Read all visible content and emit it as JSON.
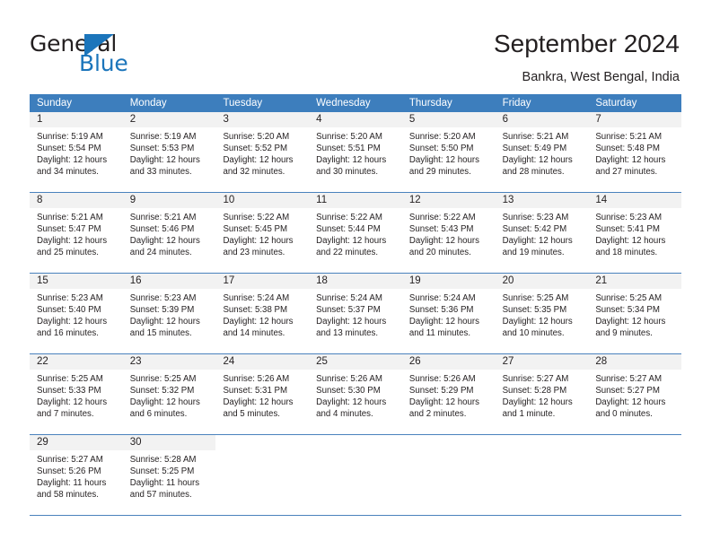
{
  "brand": {
    "name_part1": "General",
    "name_part2": "Blue"
  },
  "header": {
    "title": "September 2024",
    "subtitle": "Bankra, West Bengal, India"
  },
  "colors": {
    "header_blue": "#3d7ebd",
    "brand_blue": "#1b75bb",
    "daynum_bg": "#f2f2f2",
    "row_divider": "#4a82bd",
    "text": "#231f20"
  },
  "weekdays": [
    "Sunday",
    "Monday",
    "Tuesday",
    "Wednesday",
    "Thursday",
    "Friday",
    "Saturday"
  ],
  "weeks": [
    [
      {
        "day": "1",
        "sunrise": "Sunrise: 5:19 AM",
        "sunset": "Sunset: 5:54 PM",
        "daylight1": "Daylight: 12 hours",
        "daylight2": "and 34 minutes."
      },
      {
        "day": "2",
        "sunrise": "Sunrise: 5:19 AM",
        "sunset": "Sunset: 5:53 PM",
        "daylight1": "Daylight: 12 hours",
        "daylight2": "and 33 minutes."
      },
      {
        "day": "3",
        "sunrise": "Sunrise: 5:20 AM",
        "sunset": "Sunset: 5:52 PM",
        "daylight1": "Daylight: 12 hours",
        "daylight2": "and 32 minutes."
      },
      {
        "day": "4",
        "sunrise": "Sunrise: 5:20 AM",
        "sunset": "Sunset: 5:51 PM",
        "daylight1": "Daylight: 12 hours",
        "daylight2": "and 30 minutes."
      },
      {
        "day": "5",
        "sunrise": "Sunrise: 5:20 AM",
        "sunset": "Sunset: 5:50 PM",
        "daylight1": "Daylight: 12 hours",
        "daylight2": "and 29 minutes."
      },
      {
        "day": "6",
        "sunrise": "Sunrise: 5:21 AM",
        "sunset": "Sunset: 5:49 PM",
        "daylight1": "Daylight: 12 hours",
        "daylight2": "and 28 minutes."
      },
      {
        "day": "7",
        "sunrise": "Sunrise: 5:21 AM",
        "sunset": "Sunset: 5:48 PM",
        "daylight1": "Daylight: 12 hours",
        "daylight2": "and 27 minutes."
      }
    ],
    [
      {
        "day": "8",
        "sunrise": "Sunrise: 5:21 AM",
        "sunset": "Sunset: 5:47 PM",
        "daylight1": "Daylight: 12 hours",
        "daylight2": "and 25 minutes."
      },
      {
        "day": "9",
        "sunrise": "Sunrise: 5:21 AM",
        "sunset": "Sunset: 5:46 PM",
        "daylight1": "Daylight: 12 hours",
        "daylight2": "and 24 minutes."
      },
      {
        "day": "10",
        "sunrise": "Sunrise: 5:22 AM",
        "sunset": "Sunset: 5:45 PM",
        "daylight1": "Daylight: 12 hours",
        "daylight2": "and 23 minutes."
      },
      {
        "day": "11",
        "sunrise": "Sunrise: 5:22 AM",
        "sunset": "Sunset: 5:44 PM",
        "daylight1": "Daylight: 12 hours",
        "daylight2": "and 22 minutes."
      },
      {
        "day": "12",
        "sunrise": "Sunrise: 5:22 AM",
        "sunset": "Sunset: 5:43 PM",
        "daylight1": "Daylight: 12 hours",
        "daylight2": "and 20 minutes."
      },
      {
        "day": "13",
        "sunrise": "Sunrise: 5:23 AM",
        "sunset": "Sunset: 5:42 PM",
        "daylight1": "Daylight: 12 hours",
        "daylight2": "and 19 minutes."
      },
      {
        "day": "14",
        "sunrise": "Sunrise: 5:23 AM",
        "sunset": "Sunset: 5:41 PM",
        "daylight1": "Daylight: 12 hours",
        "daylight2": "and 18 minutes."
      }
    ],
    [
      {
        "day": "15",
        "sunrise": "Sunrise: 5:23 AM",
        "sunset": "Sunset: 5:40 PM",
        "daylight1": "Daylight: 12 hours",
        "daylight2": "and 16 minutes."
      },
      {
        "day": "16",
        "sunrise": "Sunrise: 5:23 AM",
        "sunset": "Sunset: 5:39 PM",
        "daylight1": "Daylight: 12 hours",
        "daylight2": "and 15 minutes."
      },
      {
        "day": "17",
        "sunrise": "Sunrise: 5:24 AM",
        "sunset": "Sunset: 5:38 PM",
        "daylight1": "Daylight: 12 hours",
        "daylight2": "and 14 minutes."
      },
      {
        "day": "18",
        "sunrise": "Sunrise: 5:24 AM",
        "sunset": "Sunset: 5:37 PM",
        "daylight1": "Daylight: 12 hours",
        "daylight2": "and 13 minutes."
      },
      {
        "day": "19",
        "sunrise": "Sunrise: 5:24 AM",
        "sunset": "Sunset: 5:36 PM",
        "daylight1": "Daylight: 12 hours",
        "daylight2": "and 11 minutes."
      },
      {
        "day": "20",
        "sunrise": "Sunrise: 5:25 AM",
        "sunset": "Sunset: 5:35 PM",
        "daylight1": "Daylight: 12 hours",
        "daylight2": "and 10 minutes."
      },
      {
        "day": "21",
        "sunrise": "Sunrise: 5:25 AM",
        "sunset": "Sunset: 5:34 PM",
        "daylight1": "Daylight: 12 hours",
        "daylight2": "and 9 minutes."
      }
    ],
    [
      {
        "day": "22",
        "sunrise": "Sunrise: 5:25 AM",
        "sunset": "Sunset: 5:33 PM",
        "daylight1": "Daylight: 12 hours",
        "daylight2": "and 7 minutes."
      },
      {
        "day": "23",
        "sunrise": "Sunrise: 5:25 AM",
        "sunset": "Sunset: 5:32 PM",
        "daylight1": "Daylight: 12 hours",
        "daylight2": "and 6 minutes."
      },
      {
        "day": "24",
        "sunrise": "Sunrise: 5:26 AM",
        "sunset": "Sunset: 5:31 PM",
        "daylight1": "Daylight: 12 hours",
        "daylight2": "and 5 minutes."
      },
      {
        "day": "25",
        "sunrise": "Sunrise: 5:26 AM",
        "sunset": "Sunset: 5:30 PM",
        "daylight1": "Daylight: 12 hours",
        "daylight2": "and 4 minutes."
      },
      {
        "day": "26",
        "sunrise": "Sunrise: 5:26 AM",
        "sunset": "Sunset: 5:29 PM",
        "daylight1": "Daylight: 12 hours",
        "daylight2": "and 2 minutes."
      },
      {
        "day": "27",
        "sunrise": "Sunrise: 5:27 AM",
        "sunset": "Sunset: 5:28 PM",
        "daylight1": "Daylight: 12 hours",
        "daylight2": "and 1 minute."
      },
      {
        "day": "28",
        "sunrise": "Sunrise: 5:27 AM",
        "sunset": "Sunset: 5:27 PM",
        "daylight1": "Daylight: 12 hours",
        "daylight2": "and 0 minutes."
      }
    ],
    [
      {
        "day": "29",
        "sunrise": "Sunrise: 5:27 AM",
        "sunset": "Sunset: 5:26 PM",
        "daylight1": "Daylight: 11 hours",
        "daylight2": "and 58 minutes."
      },
      {
        "day": "30",
        "sunrise": "Sunrise: 5:28 AM",
        "sunset": "Sunset: 5:25 PM",
        "daylight1": "Daylight: 11 hours",
        "daylight2": "and 57 minutes."
      },
      {
        "day": "",
        "sunrise": "",
        "sunset": "",
        "daylight1": "",
        "daylight2": ""
      },
      {
        "day": "",
        "sunrise": "",
        "sunset": "",
        "daylight1": "",
        "daylight2": ""
      },
      {
        "day": "",
        "sunrise": "",
        "sunset": "",
        "daylight1": "",
        "daylight2": ""
      },
      {
        "day": "",
        "sunrise": "",
        "sunset": "",
        "daylight1": "",
        "daylight2": ""
      },
      {
        "day": "",
        "sunrise": "",
        "sunset": "",
        "daylight1": "",
        "daylight2": ""
      }
    ]
  ]
}
